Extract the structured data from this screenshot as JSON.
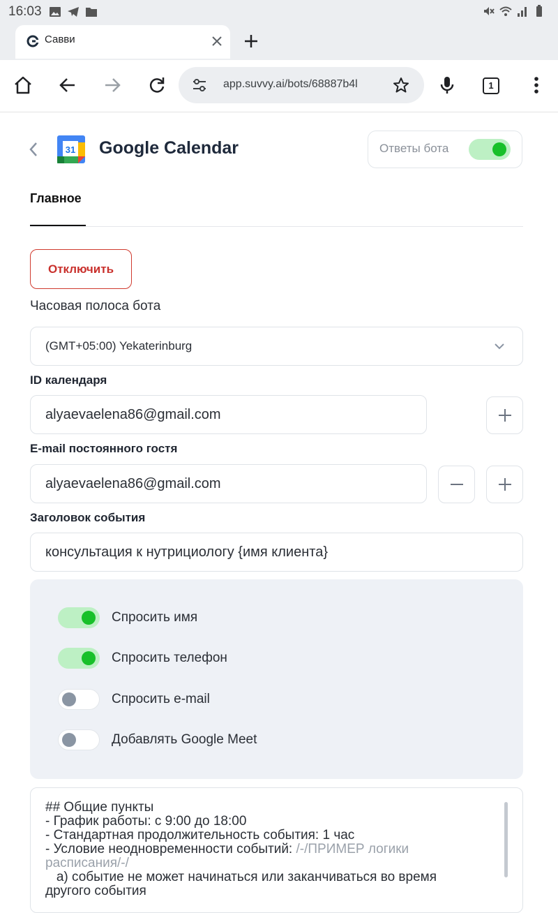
{
  "status_bar": {
    "time": "16:03"
  },
  "browser": {
    "tab_title": "Савви",
    "url": "app.suvvy.ai/bots/68887b4l",
    "tab_count": "1"
  },
  "page": {
    "title": "Google Calendar",
    "calendar_logo_text": "31",
    "bot_replies_label": "Ответы бота",
    "bot_replies_on": true,
    "tabs": [
      {
        "label": "Главное",
        "active": true
      }
    ],
    "disable_button": "Отключить",
    "timezone_label": "Часовая полоса бота",
    "timezone_value": "(GMT+05:00) Yekaterinburg",
    "calendar_id_label": "ID календаря",
    "calendar_id_value": "alyaevaelena86@gmail.com",
    "guest_email_label": "E-mail постоянного гостя",
    "guest_email_value": "alyaevaelena86@gmail.com",
    "event_title_label": "Заголовок события",
    "event_title_value": "консультация к нутрициологу {имя клиента}",
    "options": [
      {
        "label": "Спросить имя",
        "on": true
      },
      {
        "label": "Спросить телефон",
        "on": true
      },
      {
        "label": "Спросить e-mail",
        "on": false
      },
      {
        "label": "Добавлять Google Meet",
        "on": false
      }
    ],
    "prompt_lines": [
      "## Общие пункты",
      "- График работы: с 9:00 до 18:00",
      "- Стандартная продолжительность события: 1 час",
      "- Условие неодновременности событий:",
      "/-/ПРИМЕР логики",
      "расписания/-/",
      "   а) событие не может начинаться или заканчиваться во время",
      "другого события"
    ]
  },
  "colors": {
    "toggle_on_track": "#bdf0c4",
    "toggle_on_knob": "#18c02a",
    "danger": "#c9302c",
    "panel_bg": "#eef1f6"
  },
  "icons": [
    "gallery-icon",
    "telegram-icon",
    "folder-icon",
    "mute-icon",
    "wifi-icon",
    "signal-icon",
    "battery-icon",
    "home-icon",
    "back-arrow-icon",
    "forward-arrow-icon",
    "reload-icon",
    "tune-icon",
    "star-icon",
    "mic-icon",
    "more-icon",
    "plus-icon",
    "minus-icon",
    "chevron-down-icon",
    "chevron-left-icon",
    "close-icon"
  ]
}
